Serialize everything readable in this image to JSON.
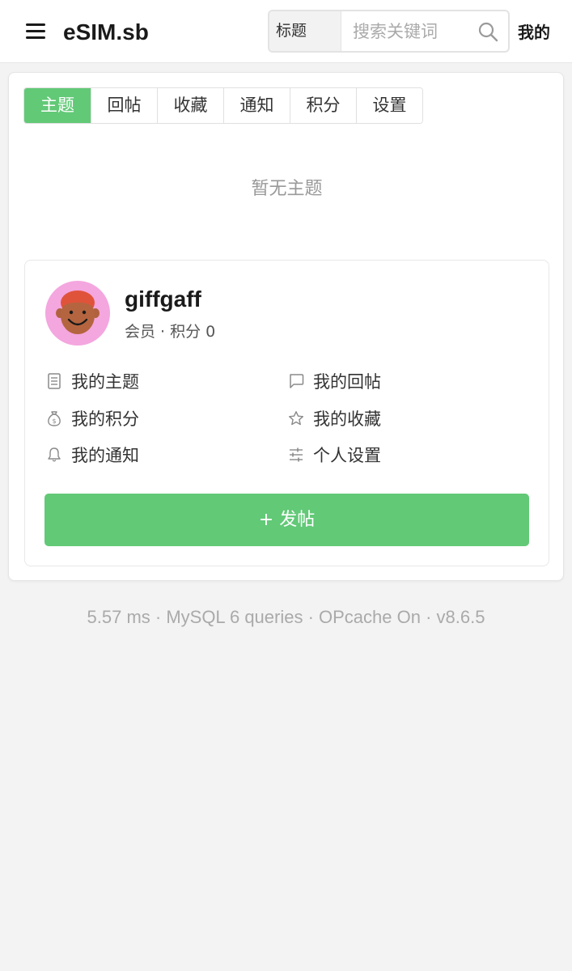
{
  "header": {
    "brand": "eSIM.sb",
    "search": {
      "scope": "标题",
      "placeholder": "搜索关键词"
    },
    "mine_label": "我的"
  },
  "tabs": [
    {
      "label": "主题",
      "active": true
    },
    {
      "label": "回帖"
    },
    {
      "label": "收藏"
    },
    {
      "label": "通知"
    },
    {
      "label": "积分"
    },
    {
      "label": "设置"
    }
  ],
  "empty_message": "暂无主题",
  "profile": {
    "username": "giffgaff",
    "meta": "会员 · 积分 0",
    "links": [
      {
        "label": "我的主题",
        "icon": "document-icon"
      },
      {
        "label": "我的回帖",
        "icon": "comment-icon"
      },
      {
        "label": "我的积分",
        "icon": "money-bag-icon"
      },
      {
        "label": "我的收藏",
        "icon": "star-icon"
      },
      {
        "label": "我的通知",
        "icon": "bell-icon"
      },
      {
        "label": "个人设置",
        "icon": "sliders-icon"
      }
    ],
    "post_button": "+ 发帖"
  },
  "footer": "5.57 ms · MySQL 6 queries · OPcache On · v8.6.5",
  "colors": {
    "accent": "#62c977",
    "avatar_bg": "#f4a6df"
  }
}
